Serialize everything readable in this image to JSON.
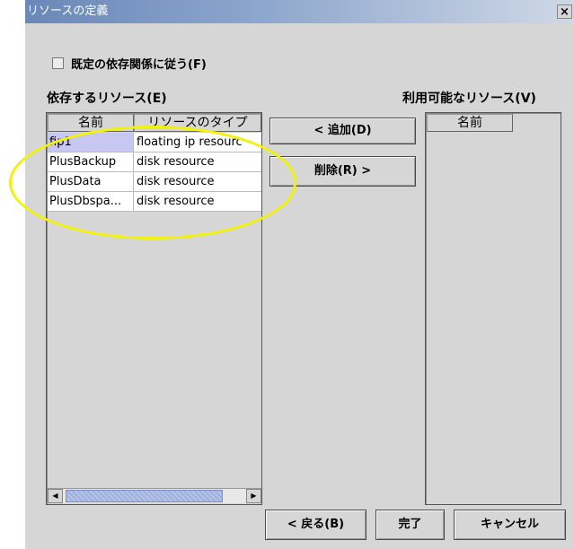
{
  "window": {
    "title": "リソースの定義",
    "close_glyph": "×"
  },
  "follow_default": {
    "label": "既定の依存関係に従う(F)",
    "checked": false
  },
  "dependent": {
    "title": "依存するリソース(E)",
    "columns": [
      "名前",
      "リソースのタイプ"
    ],
    "rows": [
      {
        "name": "fip1",
        "type": "floating ip resourc",
        "selected": true
      },
      {
        "name": "PlusBackup",
        "type": "disk resource",
        "selected": false
      },
      {
        "name": "PlusData",
        "type": "disk resource",
        "selected": false
      },
      {
        "name": "PlusDbspa...",
        "type": "disk resource",
        "selected": false
      }
    ]
  },
  "available": {
    "title": "利用可能なリソース(V)",
    "columns": [
      "名前"
    ]
  },
  "buttons": {
    "add": "< 追加(D)",
    "remove": "削除(R) >",
    "back": "< 戻る(B)",
    "finish": "完了",
    "cancel": "キャンセル"
  },
  "colors": {
    "selection": "#c7c7f2",
    "annotation": "#f2f20a"
  }
}
